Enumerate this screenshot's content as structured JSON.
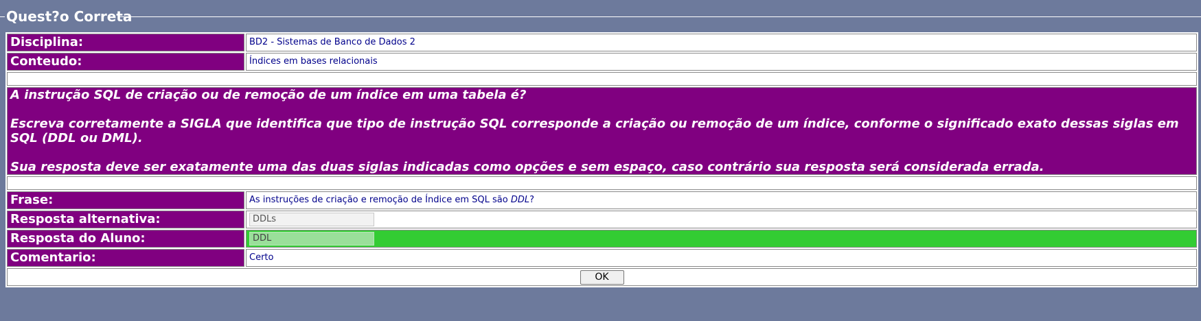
{
  "legend": "Quest?o Correta",
  "rows": {
    "disciplina": {
      "label": "Disciplina:",
      "value": "BD2 - Sistemas de Banco de Dados 2"
    },
    "conteudo": {
      "label": "Conteudo:",
      "value": "Índices em bases relacionais"
    }
  },
  "question": {
    "line1": "A instrução SQL de criação ou de remoção de um índice em uma tabela é?",
    "line2": "Escreva corretamente a SIGLA que identifica que tipo de instrução SQL corresponde a criação ou remoção de um índice, conforme o significado exato dessas siglas em SQL (DDL ou DML).",
    "line3": "Sua resposta deve ser exatamente uma das duas siglas indicadas como opções e sem espaço, caso contrário sua resposta será considerada errada."
  },
  "frase": {
    "label": "Frase:",
    "text_before": "As instruções de criação e remoção de Índice em SQL são ",
    "emphasis": "DDL",
    "text_after": "?"
  },
  "resposta_alternativa": {
    "label": "Resposta alternativa:",
    "value": "DDLs"
  },
  "resposta_aluno": {
    "label": "Resposta do Aluno:",
    "value": "DDL"
  },
  "comentario": {
    "label": "Comentario:",
    "value": "Certo"
  },
  "ok_button": "OK",
  "colors": {
    "background": "#6d7a9c",
    "label_bg": "#800080",
    "correct_bg": "#33cc33",
    "value_text": "#00008b"
  }
}
